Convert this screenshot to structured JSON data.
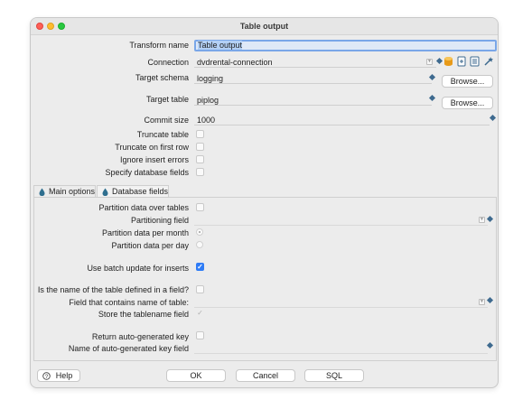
{
  "window": {
    "title": "Table output"
  },
  "form": {
    "transform_name": {
      "label": "Transform name",
      "value": "Table output"
    },
    "connection": {
      "label": "Connection",
      "value": "dvdrental-connection"
    },
    "target_schema": {
      "label": "Target schema",
      "value": "logging",
      "browse": "Browse..."
    },
    "target_table": {
      "label": "Target table",
      "value": "piplog",
      "browse": "Browse..."
    },
    "commit_size": {
      "label": "Commit size",
      "value": "1000"
    },
    "truncate_table": {
      "label": "Truncate table",
      "checked": false
    },
    "truncate_first_row": {
      "label": "Truncate on first row",
      "checked": false
    },
    "ignore_insert_errors": {
      "label": "Ignore insert errors",
      "checked": false
    },
    "specify_db_fields": {
      "label": "Specify database fields",
      "checked": false
    }
  },
  "tabs": [
    {
      "label": "Main options",
      "active": true
    },
    {
      "label": "Database fields",
      "active": false
    }
  ],
  "main_options": {
    "partition_over_tables": {
      "label": "Partition data over tables",
      "checked": false
    },
    "partitioning_field": {
      "label": "Partitioning field",
      "value": ""
    },
    "partition_per_month": {
      "label": "Partition data per month",
      "selected": true
    },
    "partition_per_day": {
      "label": "Partition data per day",
      "selected": false
    },
    "batch_update": {
      "label": "Use batch update for inserts",
      "checked": true
    },
    "name_in_field": {
      "label": "Is the name of the table defined in a field?",
      "checked": false
    },
    "field_with_name": {
      "label": "Field that contains name of table:",
      "value": ""
    },
    "store_tablename": {
      "label": "Store the tablename field",
      "checked": true
    },
    "return_keys": {
      "label": "Return auto-generated key",
      "checked": false
    },
    "key_field_name": {
      "label": "Name of auto-generated key field",
      "value": ""
    }
  },
  "buttons": {
    "help": "Help",
    "ok": "OK",
    "cancel": "Cancel",
    "sql": "SQL"
  },
  "icons": {
    "variable": "variable-diamond-icon",
    "db_icon": "database-icon",
    "new_icon": "new-connection-icon",
    "edit_icon": "edit-connection-icon",
    "wizard_icon": "wizard-icon",
    "help_icon": "help-icon",
    "tab_icon": "droplet-icon"
  },
  "colors": {
    "accent": "#2f7cf6",
    "diamond": "#3e6a8f",
    "focus": "#7aa7e8"
  }
}
